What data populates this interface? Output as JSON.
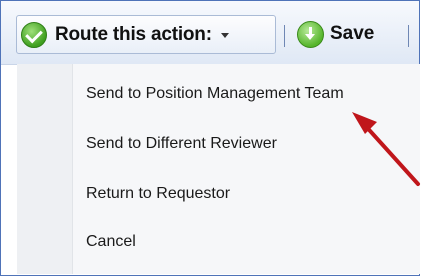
{
  "toolbar": {
    "route_label": "Route this action:",
    "save_label": "Save"
  },
  "menu": {
    "items": [
      {
        "label": "Send to Position Management Team"
      },
      {
        "label": "Send to Different Reviewer"
      },
      {
        "label": "Return to Requestor"
      },
      {
        "label": "Cancel"
      }
    ]
  },
  "colors": {
    "accent_arrow": "#c0161b",
    "frame_border": "#4f73b8",
    "check_green": "#3f9f1f"
  }
}
